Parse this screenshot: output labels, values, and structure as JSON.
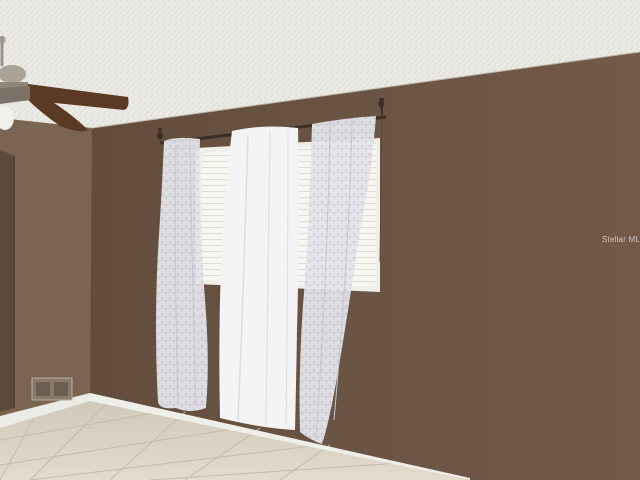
{
  "watermark": {
    "text": "Stellar MLS"
  },
  "colors": {
    "ceiling": "#ebe9e4",
    "wall_right": "#6e5645",
    "wall_back": "#644f3f",
    "wall_left": "#7a6452",
    "floor": "#ddd6c8",
    "baseboard": "#efede8",
    "curtain_white": "#f4f4f6",
    "curtain_sheer": "#dcdce4",
    "window_light": "#f6f5f0",
    "fan_blade": "#5a3a24"
  }
}
